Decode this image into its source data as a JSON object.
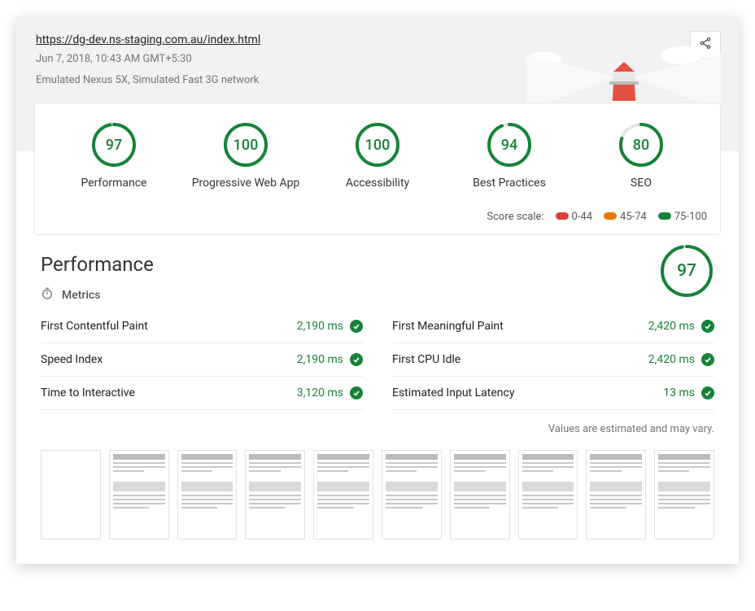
{
  "header": {
    "url": "https://dg-dev.ns-staging.com.au/index.html",
    "timestamp": "Jun 7, 2018, 10:43 AM GMT+5:30",
    "environment": "Emulated Nexus 5X, Simulated Fast 3G network"
  },
  "scores": [
    {
      "label": "Performance",
      "value": 97
    },
    {
      "label": "Progressive Web App",
      "value": 100
    },
    {
      "label": "Accessibility",
      "value": 100
    },
    {
      "label": "Best Practices",
      "value": 94
    },
    {
      "label": "SEO",
      "value": 80
    }
  ],
  "scale": {
    "label": "Score scale:",
    "ranges": [
      {
        "range": "0-44",
        "color": "#d53f3a"
      },
      {
        "range": "45-74",
        "color": "#e67700"
      },
      {
        "range": "75-100",
        "color": "#178239"
      }
    ]
  },
  "performance": {
    "title": "Performance",
    "score": 97,
    "section_label": "Metrics",
    "disclaimer": "Values are estimated and may vary.",
    "metrics_left": [
      {
        "name": "First Contentful Paint",
        "value": "2,190 ms"
      },
      {
        "name": "Speed Index",
        "value": "2,190 ms"
      },
      {
        "name": "Time to Interactive",
        "value": "3,120 ms"
      }
    ],
    "metrics_right": [
      {
        "name": "First Meaningful Paint",
        "value": "2,420 ms"
      },
      {
        "name": "First CPU Idle",
        "value": "2,420 ms"
      },
      {
        "name": "Estimated Input Latency",
        "value": "13 ms"
      }
    ],
    "filmstrip_frames": 10
  },
  "colors": {
    "pass": "#178239"
  }
}
